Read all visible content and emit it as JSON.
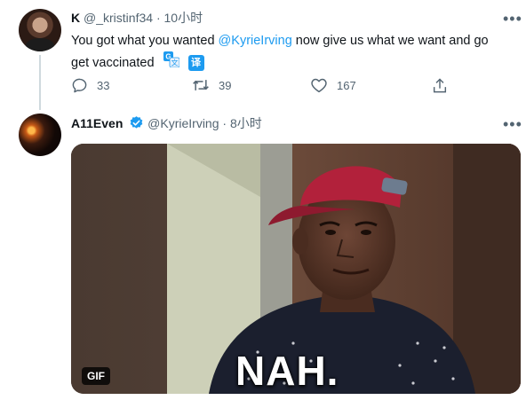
{
  "tweet1": {
    "name": "K",
    "handle": "@_kristinf34",
    "separator": "·",
    "time": "10小时",
    "text_before": "You got what you wanted ",
    "mention": "@KyrieIrving",
    "text_after": " now give us what we want and go get vaccinated",
    "translate_badge": "译",
    "replies": "33",
    "retweets": "39",
    "likes": "167",
    "more": "•••"
  },
  "tweet2": {
    "name": "A11Even",
    "handle": "@KyrieIrving",
    "separator": "·",
    "time": "8小时",
    "more": "•••",
    "media": {
      "badge": "GIF",
      "caption": "NAH."
    }
  },
  "colors": {
    "link": "#1d9bf0",
    "secondary_text": "#536471",
    "verified": "#1d9bf0",
    "thread_line": "#cfd9de"
  },
  "icons": {
    "reply": "reply-icon",
    "retweet": "retweet-icon",
    "like": "heart-icon",
    "share": "share-icon",
    "translate": "translate-icon",
    "verified": "verified-badge-icon",
    "more": "more-options-icon"
  }
}
